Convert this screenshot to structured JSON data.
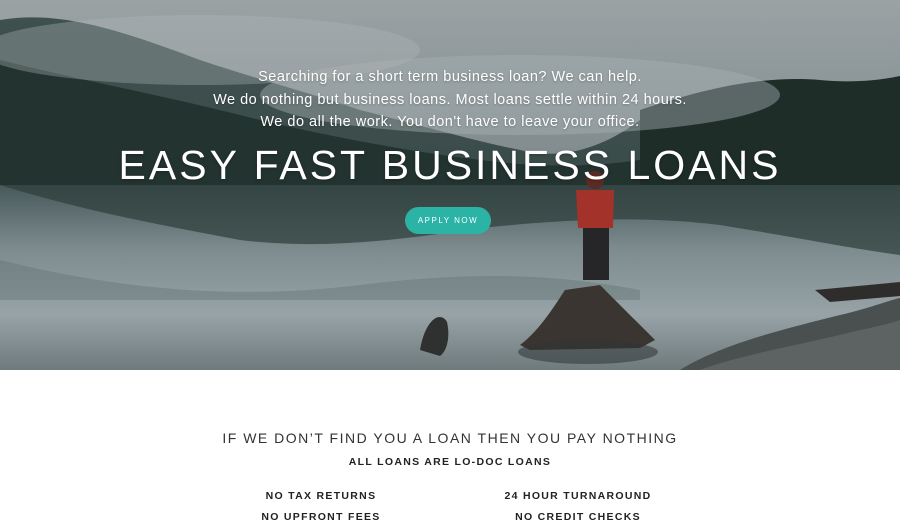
{
  "hero": {
    "intro_lines": [
      "Searching for a short term business loan? We can help.",
      "We do nothing but business loans. Most loans settle within 24 hours.",
      "We do all the work. You don't have to leave your office."
    ],
    "headline": "EASY FAST BUSINESS LOANS",
    "apply_label": "APPLY NOW",
    "accent_color": "#2bb3a6"
  },
  "section": {
    "guarantee": "IF WE DON’T FIND YOU A LOAN THEN YOU PAY NOTHING",
    "subtitle": "ALL LOANS ARE LO-DOC LOANS",
    "features": [
      "NO TAX RETURNS",
      "24 HOUR TURNAROUND",
      "NO UPFRONT FEES",
      "NO CREDIT CHECKS"
    ]
  }
}
